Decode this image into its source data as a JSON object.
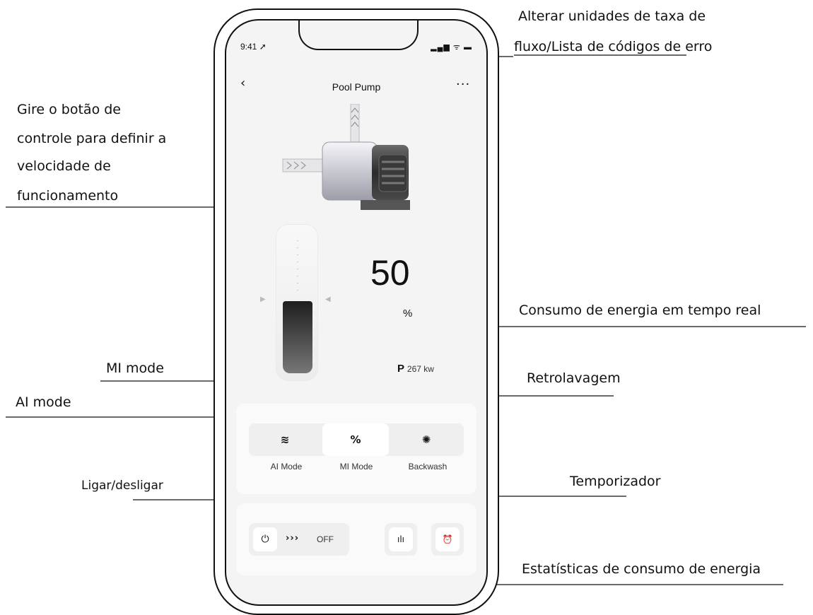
{
  "annotations": {
    "flow_units_line1": "Alterar unidades de taxa de",
    "flow_units_link": "fluxo/Lista de códigos",
    "flow_units_suffix": " de erro",
    "knob_l1": "Gire o botão de",
    "knob_l2": "controle para definir a",
    "knob_l3": "velocidade de",
    "knob_l4": "funcionamento",
    "energy_realtime": "Consumo de energia em tempo real",
    "mi_mode": "MI mode",
    "ai_mode": "AI mode",
    "backwash": "Retrolavagem",
    "power_toggle": "Ligar/desligar",
    "timer": "Temporizador",
    "energy_stats": "Estatísticas de consumo de energia"
  },
  "status_bar": {
    "time": "9:41 ➚",
    "icons": "▂▄▆ ᯤ ▬"
  },
  "header": {
    "back": "‹",
    "title": "Pool Pump",
    "more": "···"
  },
  "speed": {
    "value": "50",
    "unit": "%",
    "fill_percent": 50
  },
  "power_reading": {
    "label": "P",
    "value": "267 kw"
  },
  "modes": [
    {
      "label": "AI Mode",
      "icon": "≋",
      "icon_name": "waves-icon",
      "active": false
    },
    {
      "label": "MI Mode",
      "icon": "%",
      "icon_name": "percent-icon",
      "active": true
    },
    {
      "label": "Backwash",
      "icon": "✺",
      "icon_name": "swirl-icon",
      "active": false
    }
  ],
  "controls": {
    "power_icon": "⏻",
    "chevrons": "›››",
    "state": "OFF",
    "stats_icon": "ılı",
    "timer_icon": "⏰"
  },
  "colors": {
    "screen_bg": "#f4f4f4",
    "card_bg": "#fafafa",
    "track_bg": "#efefef"
  }
}
